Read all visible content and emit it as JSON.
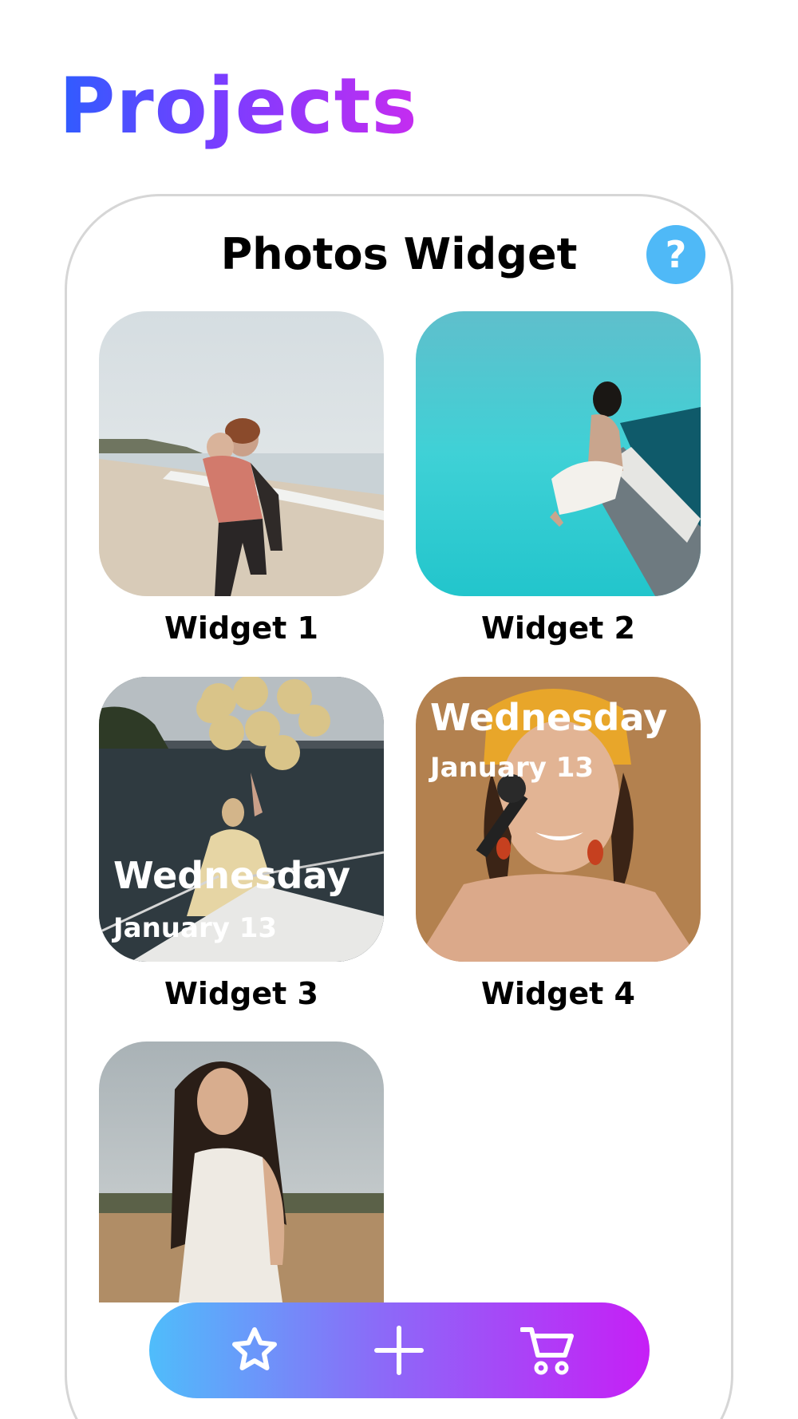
{
  "header": {
    "title": "Projects"
  },
  "card": {
    "title": "Photos Widget",
    "help_label": "?"
  },
  "widgets": [
    {
      "label": "Widget 1"
    },
    {
      "label": "Widget 2"
    },
    {
      "label": "Widget 3",
      "overlay_day": "Wednesday",
      "overlay_date": "January 13"
    },
    {
      "label": "Widget 4",
      "overlay_day": "Wednesday",
      "overlay_date": "January 13"
    },
    {
      "label": ""
    }
  ],
  "bottom_nav": {
    "items": [
      {
        "icon": "star-icon"
      },
      {
        "icon": "plus-icon"
      },
      {
        "icon": "cart-icon"
      }
    ],
    "gradient": [
      "#4fbdfb",
      "#8a6cf8",
      "#c61ff6"
    ]
  },
  "colors": {
    "title_gradient": [
      "#2f5cff",
      "#7a3dff",
      "#c62cf0"
    ],
    "help_button": "#4fb9f7"
  }
}
